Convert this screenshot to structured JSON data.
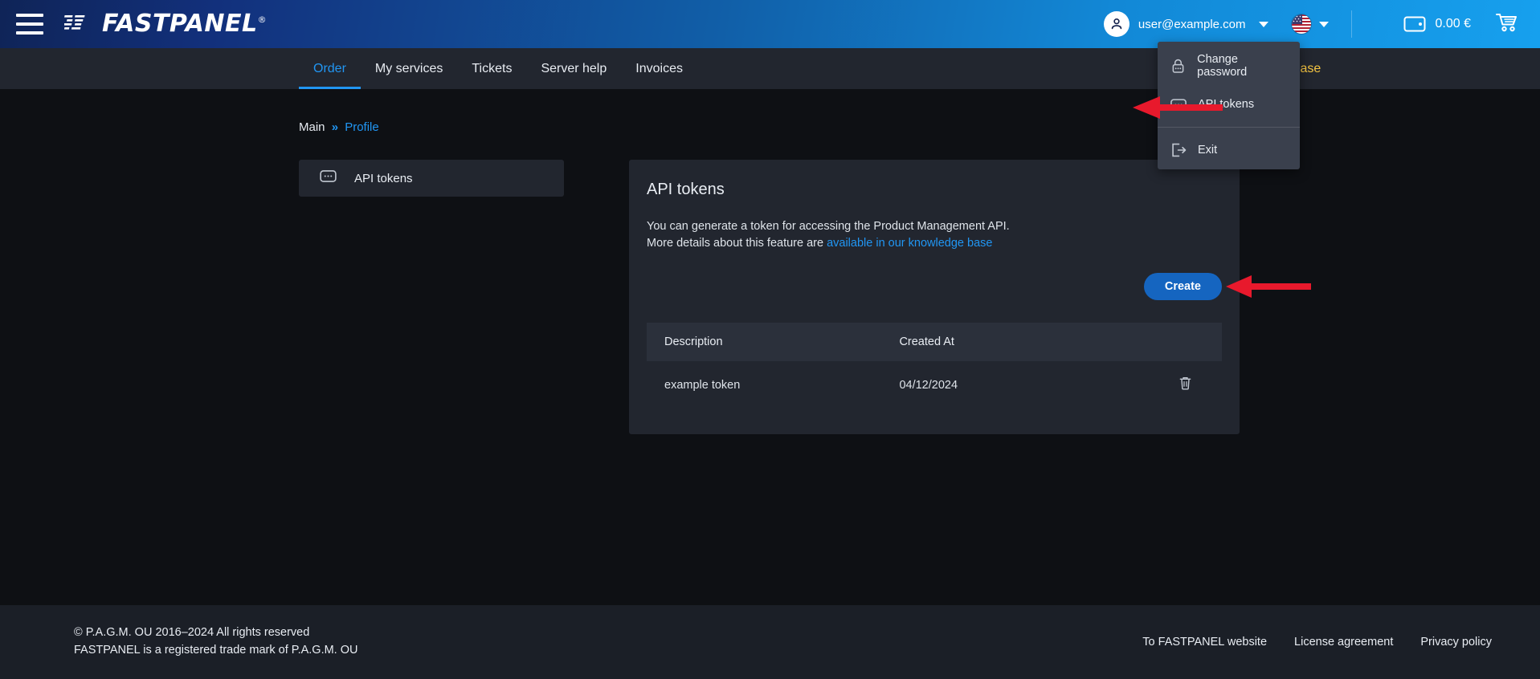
{
  "header": {
    "menu_icon": "hamburger-icon",
    "brand": "FASTPANEL",
    "brand_reg": "®",
    "user_email": "user@example.com",
    "avatar_icon": "user-avatar-icon",
    "user_caret_icon": "chevron-down-icon",
    "language": "en-US",
    "flag_icon": "us-flag-icon",
    "lang_caret_icon": "chevron-down-icon",
    "wallet_icon": "wallet-icon",
    "balance": "0.00 €",
    "cart_icon": "shopping-cart-icon"
  },
  "nav": {
    "items": [
      {
        "label": "Order",
        "active": true
      },
      {
        "label": "My services",
        "active": false
      },
      {
        "label": "Tickets",
        "active": false
      },
      {
        "label": "Server help",
        "active": false
      },
      {
        "label": "Invoices",
        "active": false
      }
    ],
    "knowledge_base": "Knowledge base"
  },
  "user_menu": {
    "items": [
      {
        "label": "Change password",
        "icon": "lock-icon"
      },
      {
        "label": "API tokens",
        "icon": "api-token-icon"
      },
      {
        "label": "Exit",
        "icon": "exit-icon"
      }
    ]
  },
  "breadcrumb": {
    "root": "Main",
    "separator": "»",
    "current": "Profile"
  },
  "sidebar": {
    "items": [
      {
        "label": "API tokens",
        "icon": "api-token-icon",
        "active": true
      }
    ]
  },
  "main": {
    "title": "API tokens",
    "desc_line1": "You can generate a token for accessing the Product Management API.",
    "desc_line2_prefix": "More details about this feature are ",
    "desc_link": "available in our knowledge base",
    "create_label": "Create",
    "table": {
      "columns": [
        "Description",
        "Created At",
        ""
      ],
      "rows": [
        {
          "description": "example token",
          "created_at": "04/12/2024",
          "delete_icon": "trash-icon"
        }
      ]
    }
  },
  "annotations": {
    "arrow_color": "#e8192c",
    "arrow_menu_target": "API tokens",
    "arrow_button_target": "Create"
  },
  "footer": {
    "copyright": "© P.A.G.M. OU 2016–2024 All rights reserved",
    "trademark": "FASTPANEL is a registered trade mark of P.A.G.M. OU",
    "links": [
      "To FASTPANEL website",
      "License agreement",
      "Privacy policy"
    ]
  },
  "colors": {
    "accent_blue": "#2196f3",
    "button_blue": "#1565c0",
    "knowledge_yellow": "#f5c542",
    "page_bg": "#0e1014",
    "card_bg": "#22262f",
    "nav_bg": "#22262f",
    "dropdown_bg": "#3a404d",
    "footer_bg": "#1b1f27"
  }
}
